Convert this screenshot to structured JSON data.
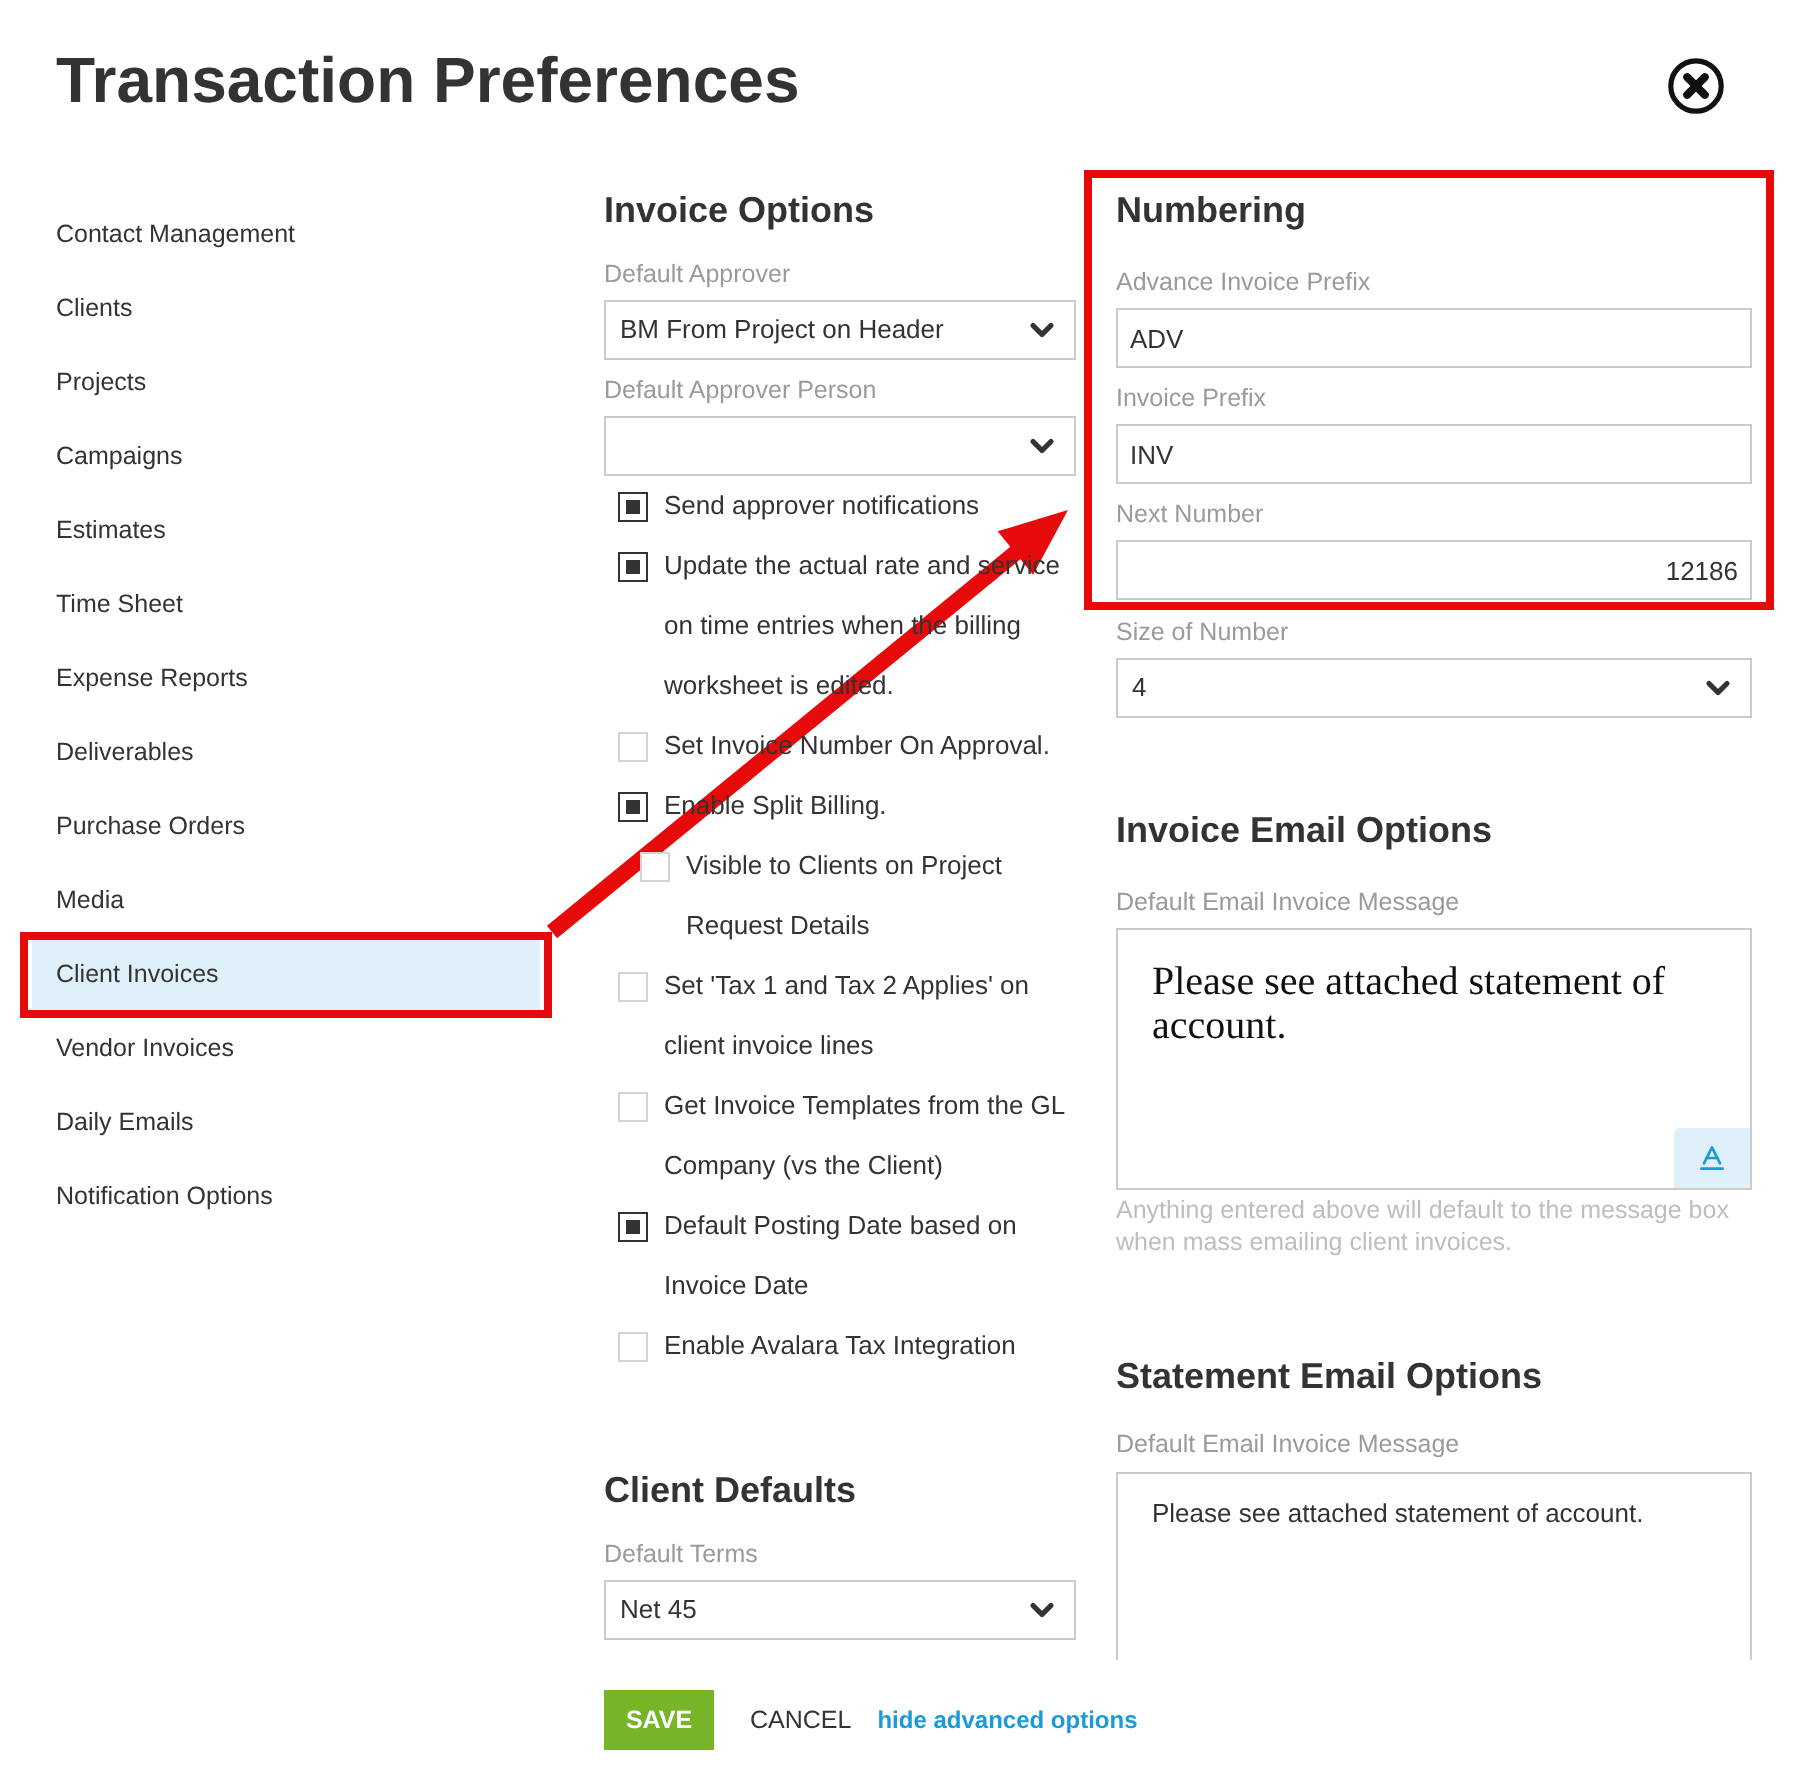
{
  "window": {
    "title": "Transaction Preferences"
  },
  "sidebar": {
    "items": [
      {
        "label": "Contact Management",
        "selected": false,
        "highlighted": false
      },
      {
        "label": "Clients",
        "selected": false,
        "highlighted": false
      },
      {
        "label": "Projects",
        "selected": false,
        "highlighted": false
      },
      {
        "label": "Campaigns",
        "selected": false,
        "highlighted": false
      },
      {
        "label": "Estimates",
        "selected": false,
        "highlighted": false
      },
      {
        "label": "Time Sheet",
        "selected": false,
        "highlighted": false
      },
      {
        "label": "Expense Reports",
        "selected": false,
        "highlighted": false
      },
      {
        "label": "Deliverables",
        "selected": false,
        "highlighted": false
      },
      {
        "label": "Purchase Orders",
        "selected": false,
        "highlighted": false
      },
      {
        "label": "Media",
        "selected": false,
        "highlighted": false
      },
      {
        "label": "Client Invoices",
        "selected": true,
        "highlighted": true
      },
      {
        "label": "Vendor Invoices",
        "selected": false,
        "highlighted": false
      },
      {
        "label": "Daily Emails",
        "selected": false,
        "highlighted": false
      },
      {
        "label": "Notification Options",
        "selected": false,
        "highlighted": false
      }
    ]
  },
  "invoice_options": {
    "heading": "Invoice Options",
    "fields": [
      {
        "kind": "select",
        "label": "Default Approver",
        "value": "BM From Project on Header"
      },
      {
        "kind": "select",
        "label": "Default Approver Person"
      }
    ],
    "options": [
      {
        "label": "Send approver notifications",
        "checked": true
      },
      {
        "label": "Update the actual rate and service on time entries when the billing worksheet is edited.",
        "checked": true
      },
      {
        "label": "Set Invoice Number On Approval.",
        "checked": false
      },
      {
        "label": "Enable Split Billing.",
        "checked": true,
        "children": [
          {
            "label": "Visible to Clients on Project Request Details",
            "checked": false
          }
        ]
      },
      {
        "label": "Set 'Tax 1 and Tax 2 Applies' on client invoice lines",
        "checked": false
      },
      {
        "label": "Get Invoice Templates from the GL Company (vs the Client)",
        "checked": false
      },
      {
        "label": "Default Posting Date based on Invoice Date",
        "checked": true
      },
      {
        "label": "Enable Avalara Tax Integration",
        "checked": false
      }
    ]
  },
  "client_defaults": {
    "heading": "Client Defaults",
    "fields": [
      {
        "kind": "select",
        "label": "Default Terms",
        "value": "Net 45"
      }
    ]
  },
  "numbering": {
    "heading": "Numbering",
    "highlighted": true,
    "fields": [
      {
        "kind": "text",
        "label": "Advance Invoice Prefix",
        "value": "ADV"
      },
      {
        "kind": "text",
        "label": "Invoice Prefix",
        "value": "INV"
      },
      {
        "kind": "number",
        "label": "Next Number",
        "value": "12186"
      }
    ],
    "after_fields": [
      {
        "kind": "select",
        "label": "Size of Number",
        "value": "4"
      }
    ]
  },
  "invoice_email_options": {
    "heading": "Invoice Email Options",
    "label": "Default Email Invoice Message",
    "message": "Please see attached statement of account.",
    "hint": "Anything entered above will default to the message box when mass emailing client invoices."
  },
  "statement_email_options": {
    "heading": "Statement Email Options",
    "label": "Default Email Invoice Message",
    "message": "Please see attached statement of account."
  },
  "actions": {
    "save": "SAVE",
    "cancel": "CANCEL",
    "link": "hide advanced options"
  },
  "annotations": {
    "arrow": true
  }
}
